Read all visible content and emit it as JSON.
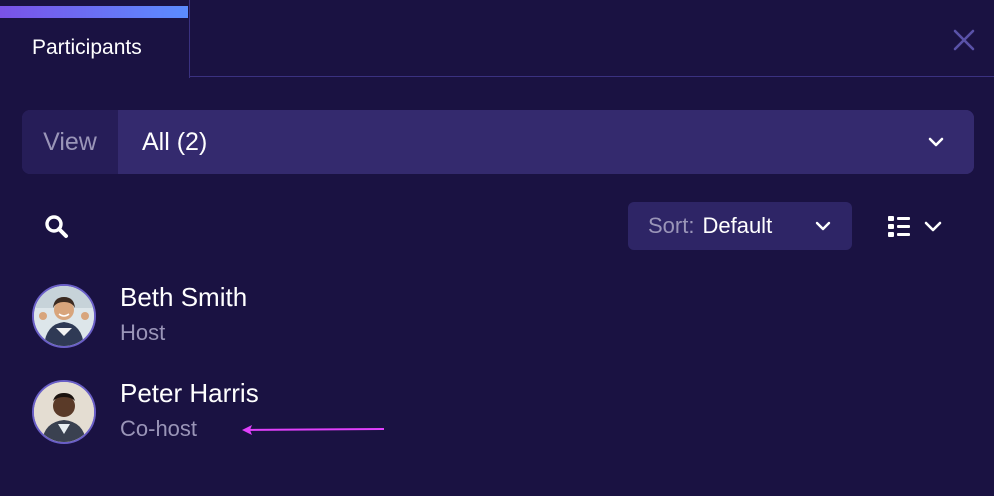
{
  "tab": {
    "label": "Participants"
  },
  "view": {
    "prefix": "View",
    "value": "All (2)"
  },
  "sort": {
    "prefix": "Sort:",
    "value": "Default"
  },
  "participants": [
    {
      "name": "Beth Smith",
      "role": "Host"
    },
    {
      "name": "Peter Harris",
      "role": "Co-host"
    }
  ],
  "colors": {
    "background": "#1a1242",
    "accent_start": "#7a52e8",
    "accent_end": "#5b8cff",
    "annotation_arrow": "#e040fb"
  },
  "icons": [
    "close-icon",
    "chevron-down-icon",
    "search-icon",
    "list-view-icon"
  ]
}
